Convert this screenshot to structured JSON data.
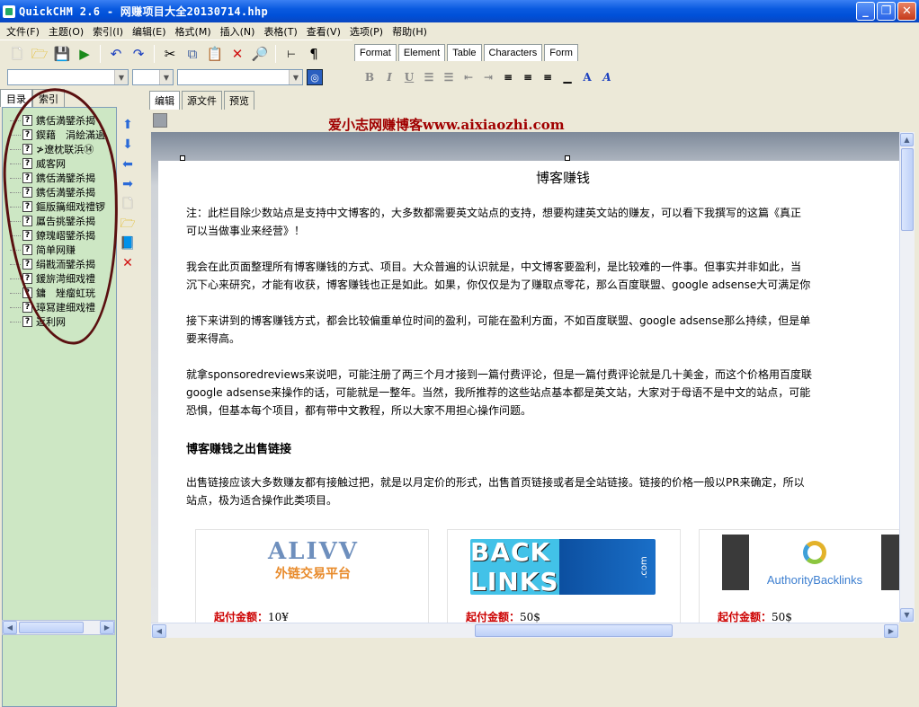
{
  "window": {
    "title": "QuickCHM 2.6 - 网赚项目大全20130714.hhp"
  },
  "menu": [
    "文件(F)",
    "主题(O)",
    "索引(I)",
    "编辑(E)",
    "格式(M)",
    "插入(N)",
    "表格(T)",
    "查看(V)",
    "选项(P)",
    "帮助(H)"
  ],
  "format_tabs": [
    "Format",
    "Element",
    "Table",
    "Characters",
    "Form"
  ],
  "left_tabs": [
    "目录",
    "索引"
  ],
  "tree_items": [
    "鎸佸満鐾杀揭",
    "鍥藉　涓絵滿過",
    "≯遼枕联浜⑭",
    "威客网",
    "鎸佸満鐾杀揭",
    "鎸佸満鐾杀揭",
    "鏂版簼细戏禮锣",
    "屭告挑鐾杀揭",
    "鐐瑰嶍鐾杀揭",
    "简单网赚",
    "绢戡洏鐾杀揭",
    "鍰旂渮细戏禮",
    "鏞　矬瘤虹珖",
    "璋冩建细戏禮",
    "返利网"
  ],
  "editor_tabs": [
    "编辑",
    "源文件",
    "预览"
  ],
  "doc": {
    "blog_header": "爱小志网赚博客www.aixiaozhi.com",
    "title": "博客赚钱",
    "p1a": "注：此栏目除少数站点是支持中文博客的，大多数都需要英文站点的支持，想要构建英文站的赚友，可以看下我撰写的这篇《真正",
    "p1b": "可以当做事业来经营》！",
    "p2a": "我会在此页面整理所有博客赚钱的方式、项目。大众普遍的认识就是，中文博客要盈利，是比较难的一件事。但事实并非如此，当",
    "p2b": "沉下心来研究，才能有收获，博客赚钱也正是如此。如果，你仅仅是为了赚取点零花，那么百度联盟、google adsense大可满足你",
    "p3a": "接下来讲到的博客赚钱方式，都会比较偏重单位时间的盈利，可能在盈利方面，不如百度联盟、google adsense那么持续，但是单",
    "p3b": "要来得高。",
    "p4a": "就拿sponsoredreviews来说吧，可能注册了两三个月才接到一篇付费评论，但是一篇付费评论就是几十美金，而这个价格用百度联",
    "p4b": "google adsense来操作的话，可能就是一整年。当然，我所推荐的这些站点基本都是英文站，大家对于母语不是中文的站点，可能",
    "p4c": "恐惧，但基本每个项目，都有带中文教程，所以大家不用担心操作问题。",
    "subtitle": "博客赚钱之出售链接",
    "p5a": "出售链接应该大多数赚友都有接触过把，就是以月定价的形式，出售首页链接或者是全站链接。链接的价格一般以PR来确定，所以",
    "p5b": "站点，极为适合操作此类项目。",
    "cards": [
      {
        "logo": "ALIVV",
        "logo_sub": "外链交易平台",
        "price_label": "起付金额：",
        "price": "10¥"
      },
      {
        "logo": "BACK LINKS",
        "logo_sub": ".com",
        "price_label": "起付金额：",
        "price": "50$"
      },
      {
        "logo": "AuthorityBacklinks",
        "logo_sub": "",
        "price_label": "起付金额：",
        "price": "50$"
      }
    ]
  },
  "colors": {
    "title_blue": "#0a5ae0",
    "tree_bg": "#cde7c4",
    "blog_red": "#a00000"
  }
}
